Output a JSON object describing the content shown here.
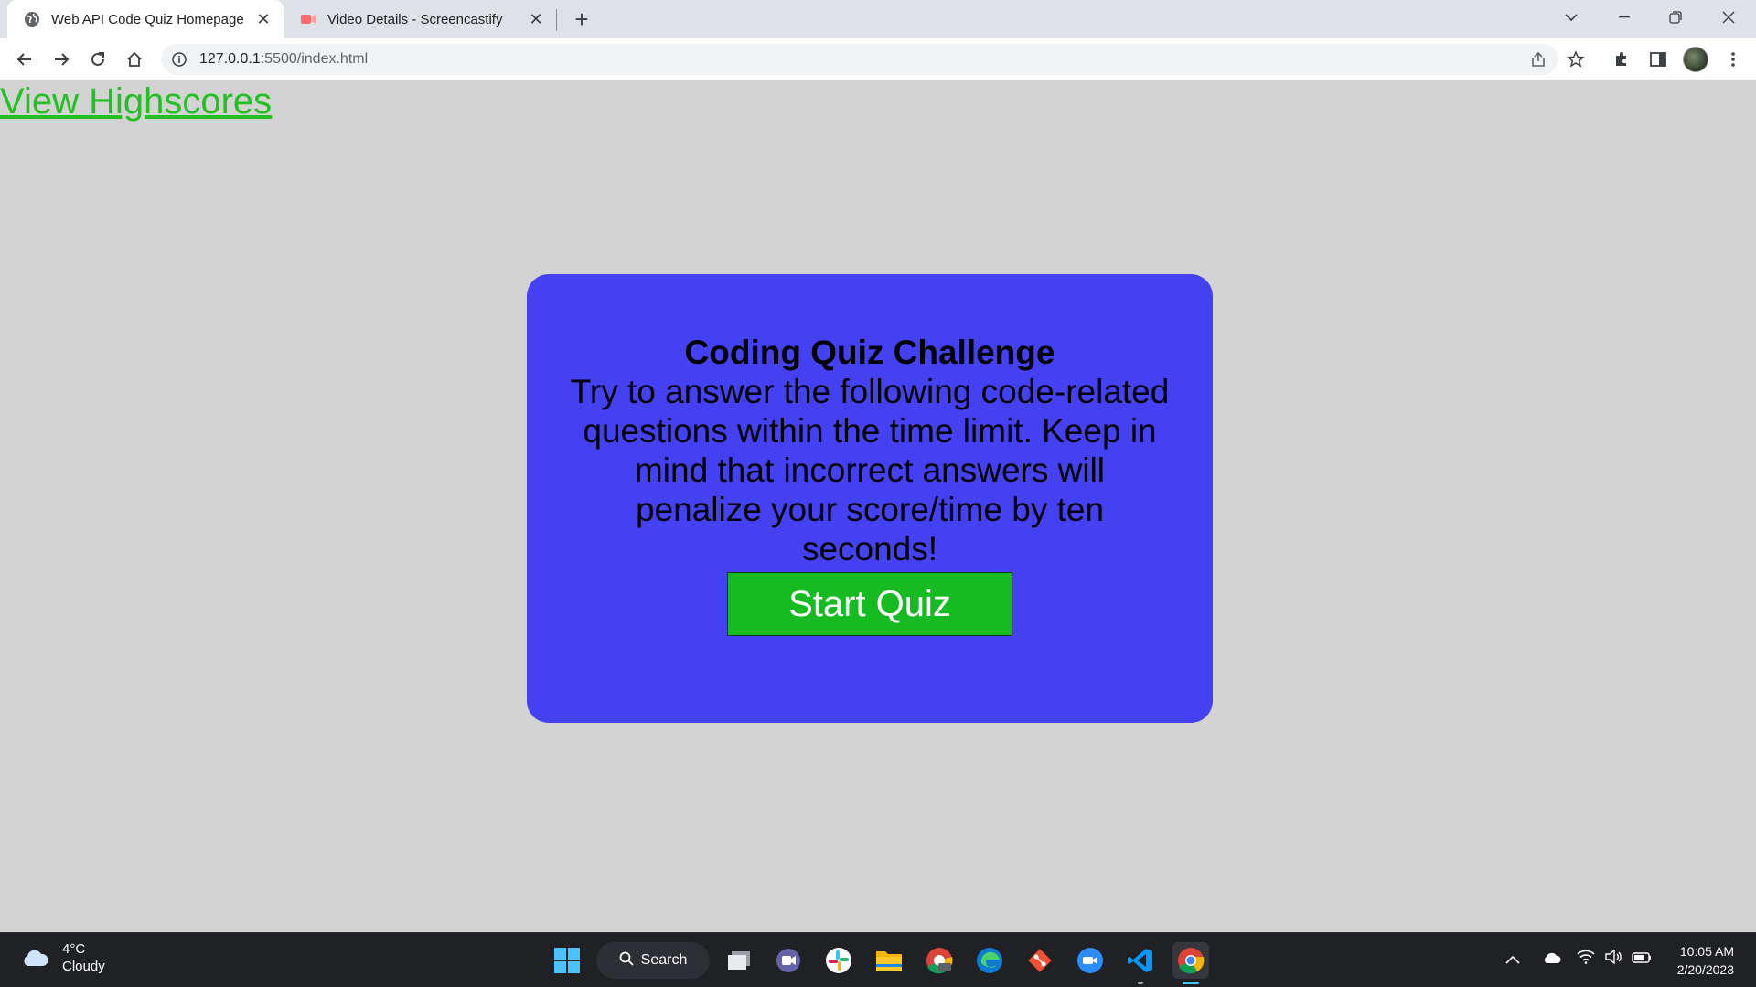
{
  "browser": {
    "tabs": [
      {
        "title": "Web API Code Quiz Homepage",
        "icon": "globe-icon",
        "active": true
      },
      {
        "title": "Video Details - Screencastify",
        "icon": "screencastify-icon",
        "active": false
      }
    ],
    "new_tab_label": "+",
    "url": {
      "host": "127.0.0.1",
      "path": ":5500/index.html"
    }
  },
  "page": {
    "highscores_link": "View Highscores",
    "title": "Coding Quiz Challenge",
    "description": "Try to answer the following code-related questions within the time limit. Keep in mind that incorrect answers will penalize your score/time by ten seconds!",
    "start_button": "Start Quiz"
  },
  "taskbar": {
    "weather": {
      "temp": "4°C",
      "condition": "Cloudy"
    },
    "search_label": "Search",
    "apps": [
      "start-icon",
      "task-view-icon",
      "teams-icon",
      "slack-icon",
      "file-explorer-icon",
      "chrome-dev-icon",
      "edge-icon",
      "git-icon",
      "zoom-icon",
      "vscode-icon",
      "chrome-icon"
    ],
    "time": "10:05 AM",
    "date": "2/20/2023"
  },
  "colors": {
    "page_bg": "#d3d3d3",
    "card_bg": "#4441f2",
    "start_button_bg": "#16bb22",
    "link": "#22c022"
  }
}
